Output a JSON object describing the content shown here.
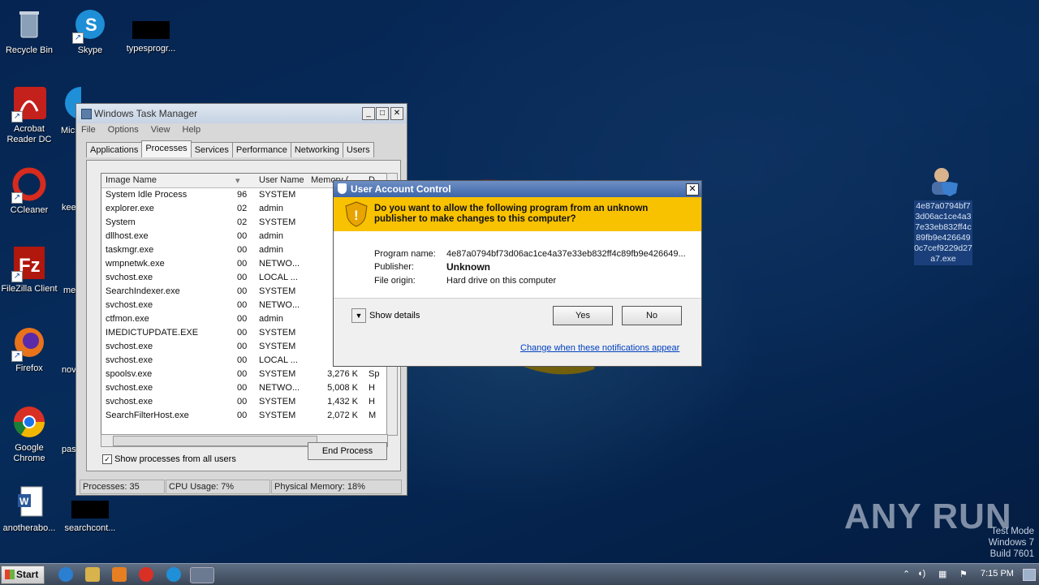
{
  "desktop_icons": [
    {
      "label": "Recycle Bin"
    },
    {
      "label": "Skype"
    },
    {
      "label": "typesprogr..."
    },
    {
      "label": "Acrobat Reader DC"
    },
    {
      "label": "Micr"
    },
    {
      "label": "CCleaner"
    },
    {
      "label": "kee"
    },
    {
      "label": "FileZilla Client"
    },
    {
      "label": "me"
    },
    {
      "label": "Firefox"
    },
    {
      "label": "nov"
    },
    {
      "label": "Google Chrome"
    },
    {
      "label": "pas"
    },
    {
      "label": "anotherabo..."
    },
    {
      "label": "searchcont..."
    }
  ],
  "task_manager": {
    "title": "Windows Task Manager",
    "menu": [
      "File",
      "Options",
      "View",
      "Help"
    ],
    "tabs": [
      "Applications",
      "Processes",
      "Services",
      "Performance",
      "Networking",
      "Users"
    ],
    "active_tab": "Processes",
    "columns": [
      "Image Name",
      "User Name",
      "Memory (...",
      "D"
    ],
    "processes": [
      {
        "name": "System Idle Process",
        "id": "96",
        "user": "SYSTEM",
        "mem": "",
        "d": ""
      },
      {
        "name": "explorer.exe",
        "id": "02",
        "user": "admin",
        "mem": "22",
        "d": ""
      },
      {
        "name": "System",
        "id": "02",
        "user": "SYSTEM",
        "mem": "",
        "d": ""
      },
      {
        "name": "dllhost.exe",
        "id": "00",
        "user": "admin",
        "mem": "",
        "d": ""
      },
      {
        "name": "taskmgr.exe",
        "id": "00",
        "user": "admin",
        "mem": "2",
        "d": ""
      },
      {
        "name": "wmpnetwk.exe",
        "id": "00",
        "user": "NETWO...",
        "mem": "1",
        "d": ""
      },
      {
        "name": "svchost.exe",
        "id": "00",
        "user": "LOCAL ...",
        "mem": "1",
        "d": ""
      },
      {
        "name": "SearchIndexer.exe",
        "id": "00",
        "user": "SYSTEM",
        "mem": "6",
        "d": ""
      },
      {
        "name": "svchost.exe",
        "id": "00",
        "user": "NETWO...",
        "mem": "1",
        "d": ""
      },
      {
        "name": "ctfmon.exe",
        "id": "00",
        "user": "admin",
        "mem": "",
        "d": ""
      },
      {
        "name": "IMEDICTUPDATE.EXE",
        "id": "00",
        "user": "SYSTEM",
        "mem": "",
        "d": ""
      },
      {
        "name": "svchost.exe",
        "id": "00",
        "user": "SYSTEM",
        "mem": "2",
        "d": ""
      },
      {
        "name": "svchost.exe",
        "id": "00",
        "user": "LOCAL ...",
        "mem": "4",
        "d": ""
      },
      {
        "name": "spoolsv.exe",
        "id": "00",
        "user": "SYSTEM",
        "mem": "3,276 K",
        "d": "Sp"
      },
      {
        "name": "svchost.exe",
        "id": "00",
        "user": "NETWO...",
        "mem": "5,008 K",
        "d": "H"
      },
      {
        "name": "svchost.exe",
        "id": "00",
        "user": "SYSTEM",
        "mem": "1,432 K",
        "d": "H"
      },
      {
        "name": "SearchFilterHost.exe",
        "id": "00",
        "user": "SYSTEM",
        "mem": "2,072 K",
        "d": "M"
      }
    ],
    "show_all_label": "Show processes from all users",
    "end_process_label": "End Process",
    "status": {
      "processes": "Processes: 35",
      "cpu": "CPU Usage: 7%",
      "memory": "Physical Memory: 18%"
    }
  },
  "uac": {
    "title": "User Account Control",
    "question": "Do you want to allow the following program from an unknown publisher to make changes to this computer?",
    "program_name_label": "Program name:",
    "program_name": "4e87a0794bf73d06ac1ce4a37e33eb832ff4c89fb9e426649...",
    "publisher_label": "Publisher:",
    "publisher": "Unknown",
    "file_origin_label": "File origin:",
    "file_origin": "Hard drive on this computer",
    "show_details": "Show details",
    "yes": "Yes",
    "no": "No",
    "change_link": "Change when these notifications appear"
  },
  "right_file": {
    "label": "4e87a0794bf73d06ac1ce4a37e33eb832ff4c89fb9e4266490c7cef9229d27a7.exe"
  },
  "watermark": {
    "line1": "Test Mode",
    "line2": "Windows 7",
    "line3": "Build 7601"
  },
  "brand": "ANY RUN",
  "taskbar": {
    "start": "Start",
    "time": "7:15 PM"
  }
}
